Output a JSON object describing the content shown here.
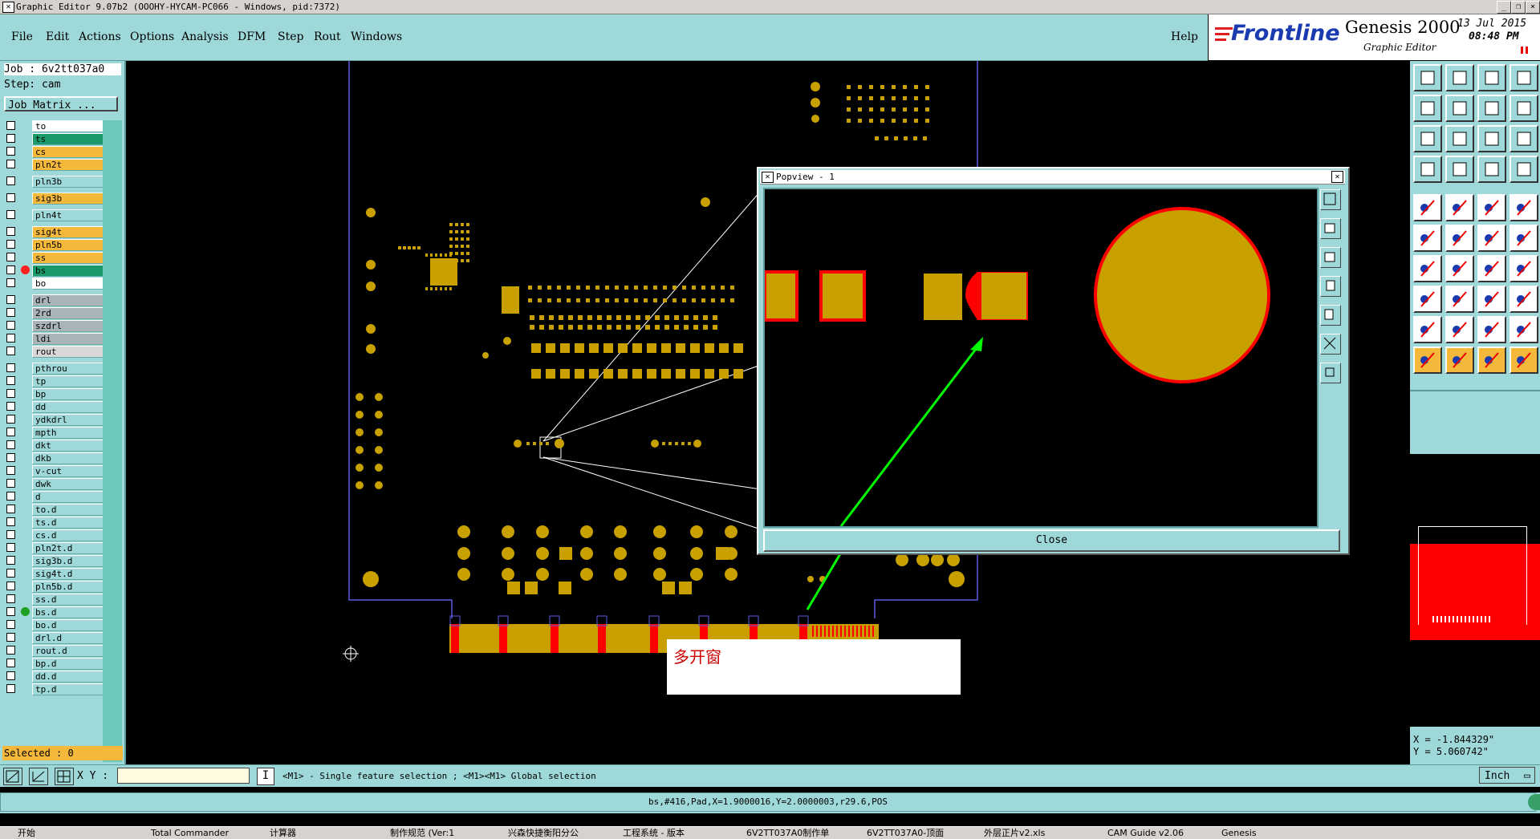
{
  "window": {
    "title": "Graphic Editor 9.07b2 (OOOHY-HYCAM-PC066 - Windows, pid:7372)",
    "controls": [
      "_",
      "❐",
      "×"
    ]
  },
  "menu": {
    "items": [
      "File",
      "Edit",
      "Actions",
      "Options",
      "Analysis",
      "DFM",
      "Step",
      "Rout",
      "Windows"
    ],
    "help": "Help"
  },
  "brand": {
    "logo": "Frontline",
    "product": "Genesis 2000",
    "subtitle": "Graphic Editor",
    "date": "13 Jul 2015",
    "time": "08:48 PM"
  },
  "job": {
    "job_label": "Job : 6v2tt037a0",
    "step_label": "Step: cam",
    "matrix_button": "Job Matrix ..."
  },
  "layers": [
    {
      "name": "to",
      "color": "#ffffff"
    },
    {
      "name": "ts",
      "color": "#1a9a6a"
    },
    {
      "name": "cs",
      "color": "#f4b83a"
    },
    {
      "name": "pln2t",
      "color": "#f4b83a"
    },
    {
      "name": "pln3b",
      "color": "#9ed8d8"
    },
    {
      "name": "sig3b",
      "color": "#f4b83a"
    },
    {
      "name": "pln4t",
      "color": "#9ed8d8"
    },
    {
      "name": "sig4t",
      "color": "#f4b83a"
    },
    {
      "name": "pln5b",
      "color": "#f4b83a"
    },
    {
      "name": "ss",
      "color": "#f4b83a"
    },
    {
      "name": "bs",
      "color": "#1a9a6a"
    },
    {
      "name": "bo",
      "color": "#ffffff"
    },
    {
      "name": "drl",
      "color": "#a8b4b8"
    },
    {
      "name": "2rd",
      "color": "#a8b4b8"
    },
    {
      "name": "szdrl",
      "color": "#a8b4b8"
    },
    {
      "name": "ldi",
      "color": "#a8b4b8"
    },
    {
      "name": "rout",
      "color": "#d8d8d8"
    },
    {
      "name": "pthrou",
      "color": "#9ed8d8"
    },
    {
      "name": "tp",
      "color": "#9ed8d8"
    },
    {
      "name": "bp",
      "color": "#9ed8d8"
    },
    {
      "name": "dd",
      "color": "#9ed8d8"
    },
    {
      "name": "ydkdrl",
      "color": "#9ed8d8"
    },
    {
      "name": "mpth",
      "color": "#9ed8d8"
    },
    {
      "name": "dkt",
      "color": "#9ed8d8"
    },
    {
      "name": "dkb",
      "color": "#9ed8d8"
    },
    {
      "name": "v-cut",
      "color": "#9ed8d8"
    },
    {
      "name": "dwk",
      "color": "#9ed8d8"
    },
    {
      "name": "d",
      "color": "#9ed8d8"
    },
    {
      "name": "to.d",
      "color": "#9ed8d8"
    },
    {
      "name": "ts.d",
      "color": "#9ed8d8"
    },
    {
      "name": "cs.d",
      "color": "#9ed8d8"
    },
    {
      "name": "pln2t.d",
      "color": "#9ed8d8"
    },
    {
      "name": "sig3b.d",
      "color": "#9ed8d8"
    },
    {
      "name": "sig4t.d",
      "color": "#9ed8d8"
    },
    {
      "name": "pln5b.d",
      "color": "#9ed8d8"
    },
    {
      "name": "ss.d",
      "color": "#9ed8d8"
    },
    {
      "name": "bs.d",
      "color": "#9ed8d8"
    },
    {
      "name": "bo.d",
      "color": "#9ed8d8"
    },
    {
      "name": "drl.d",
      "color": "#9ed8d8"
    },
    {
      "name": "rout.d",
      "color": "#9ed8d8"
    },
    {
      "name": "bp.d",
      "color": "#9ed8d8"
    },
    {
      "name": "dd.d",
      "color": "#9ed8d8"
    },
    {
      "name": "tp.d",
      "color": "#9ed8d8"
    }
  ],
  "selected": "Selected : 0",
  "popview": {
    "title": "Popview - 1",
    "close_label": "Close"
  },
  "annotation": "多开窗",
  "coords": {
    "x": "X = -1.844329\"",
    "y": "Y = 5.060742\""
  },
  "bottom": {
    "xy_label": "X Y :",
    "xy_value": "",
    "hint": "<M1> - Single feature selection ; <M1><M1> Global selection",
    "units": "Inch",
    "status": "bs,#416,Pad,X=1.9000016,Y=2.0000003,r29.6,POS"
  },
  "taskbar": [
    "开始",
    "Total Commander",
    "计算器",
    "制作规范 (Ver:1",
    "兴森快捷衡阳分公",
    "工程系统 - 版本",
    "6V2TT037A0制作单",
    "6V2TT037A0-顶面",
    "外层正片v2.xls",
    "CAM Guide v2.06",
    "Genesis"
  ],
  "colors": {
    "panel": "#9ed8d8",
    "copper": "#c8a000",
    "highlight": "#ff0000",
    "arrow": "#00ff00",
    "board_outline": "#5a5ae0"
  }
}
